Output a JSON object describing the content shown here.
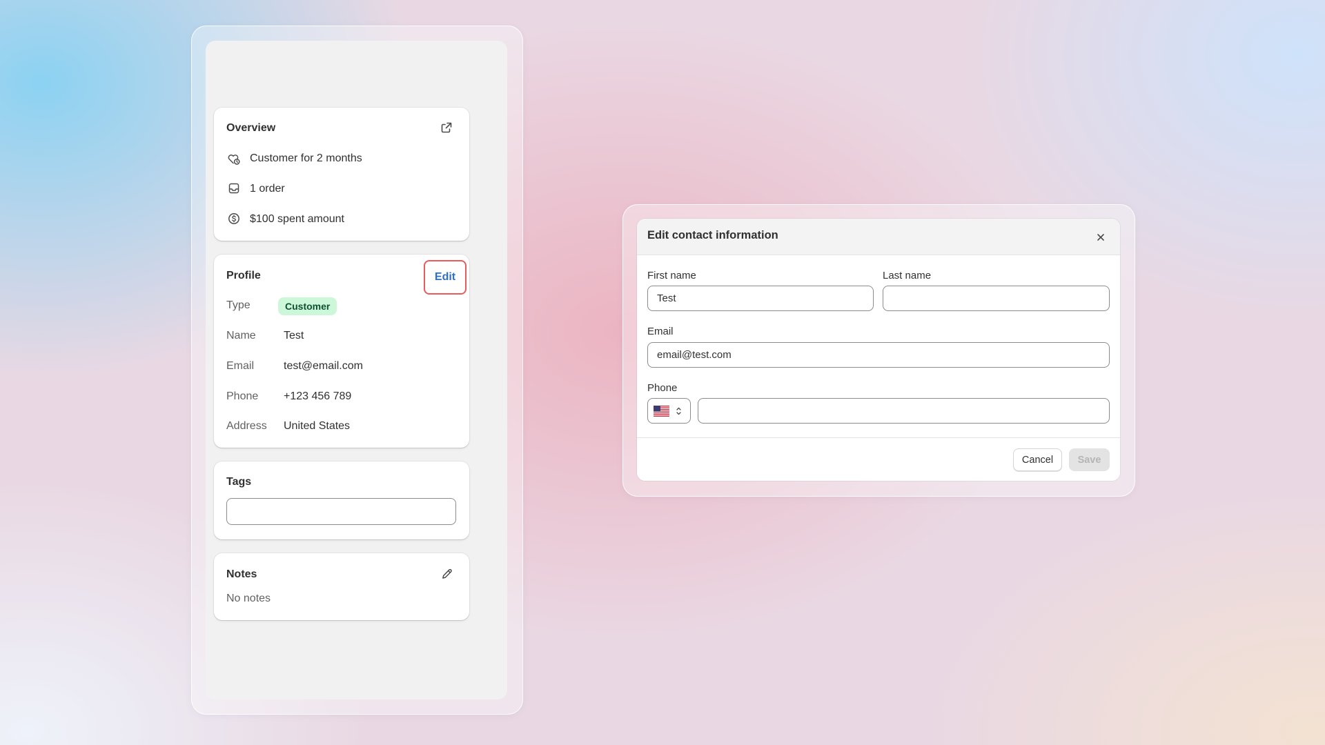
{
  "overview": {
    "title": "Overview",
    "items": [
      {
        "icon": "customer-since-icon",
        "text": "Customer for 2 months"
      },
      {
        "icon": "order-icon",
        "text": "1 order"
      },
      {
        "icon": "dollar-icon",
        "text": "$100 spent amount"
      }
    ]
  },
  "profile": {
    "title": "Profile",
    "edit_label": "Edit",
    "rows": [
      {
        "key": "Type",
        "value": "Customer"
      },
      {
        "key": "Name",
        "value": "Test"
      },
      {
        "key": "Email",
        "value": "test@email.com"
      },
      {
        "key": "Phone",
        "value": "+123 456 789"
      },
      {
        "key": "Address",
        "value": "United States"
      }
    ]
  },
  "tags": {
    "title": "Tags",
    "value": ""
  },
  "notes": {
    "title": "Notes",
    "empty_text": "No notes"
  },
  "modal": {
    "title": "Edit contact information",
    "first_name": {
      "label": "First name",
      "value": "Test"
    },
    "last_name": {
      "label": "Last name",
      "value": ""
    },
    "email": {
      "label": "Email",
      "value": "email@test.com"
    },
    "phone": {
      "label": "Phone",
      "country": "US",
      "value": ""
    },
    "cancel_label": "Cancel",
    "save_label": "Save"
  },
  "colors": {
    "accent_link": "#2c6ecb",
    "highlight_border": "#ea5a5c",
    "badge_bg": "#cdf7d9",
    "badge_text": "#0c5132",
    "disabled_button": "#e3e3e3"
  }
}
